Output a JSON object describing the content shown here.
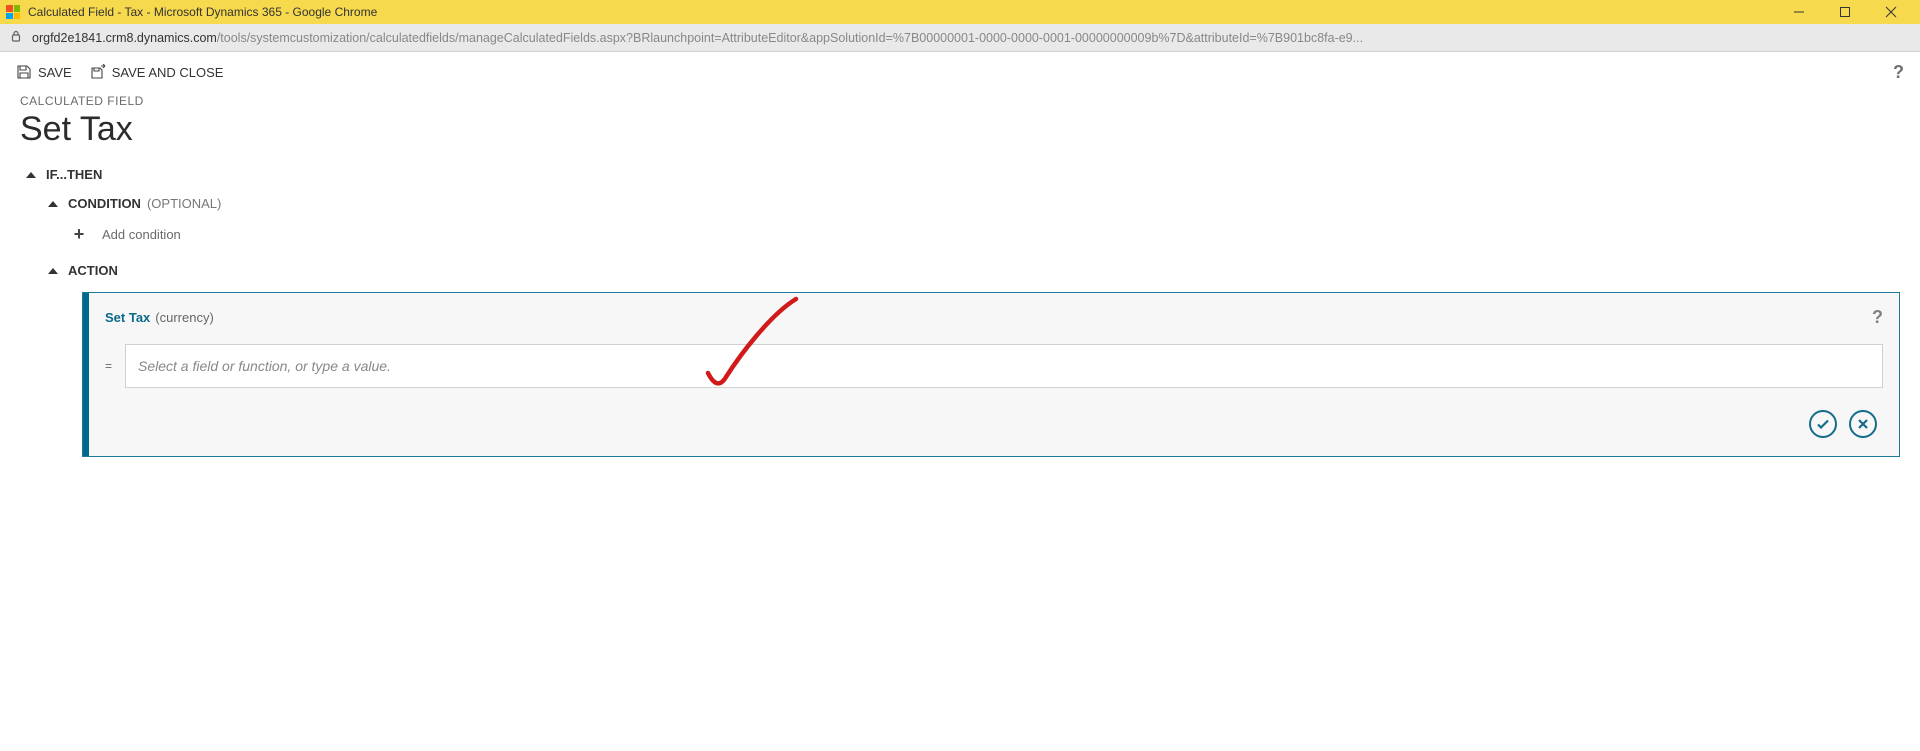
{
  "window": {
    "title": "Calculated Field - Tax - Microsoft Dynamics 365 - Google Chrome"
  },
  "address": {
    "host": "orgfd2e1841.crm8.dynamics.com",
    "path": "/tools/systemcustomization/calculatedfields/manageCalculatedFields.aspx?BRlaunchpoint=AttributeEditor&appSolutionId=%7B00000001-0000-0000-0001-00000000009b%7D&attributeId=%7B901bc8fa-e9..."
  },
  "toolbar": {
    "save_label": "SAVE",
    "save_close_label": "SAVE AND CLOSE",
    "help_glyph": "?"
  },
  "page": {
    "entity_label": "CALCULATED FIELD",
    "title": "Set Tax"
  },
  "sections": {
    "if_then": "IF...THEN",
    "condition": "CONDITION",
    "condition_opt": "(OPTIONAL)",
    "add_condition": "Add condition",
    "action": "ACTION"
  },
  "action_box": {
    "set_field_name": "Set Tax",
    "set_field_type": "(currency)",
    "formula_placeholder": "Select a field or function, or type a value.",
    "equals": "=",
    "help_glyph": "?"
  }
}
